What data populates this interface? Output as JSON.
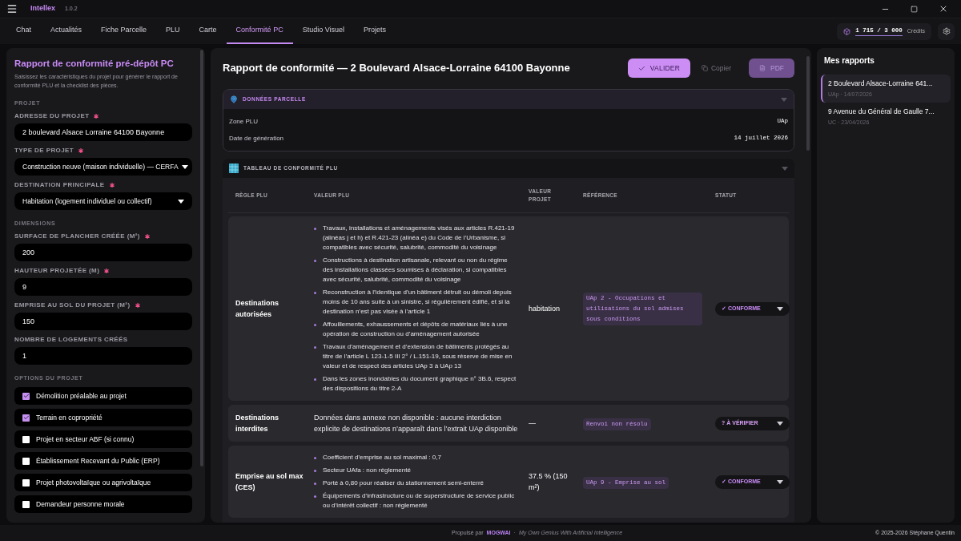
{
  "app": {
    "name": "Intellex",
    "version": "1.0.2"
  },
  "tabs": [
    {
      "label": "Chat",
      "selected": false
    },
    {
      "label": "Actualités",
      "selected": false
    },
    {
      "label": "Fiche Parcelle",
      "selected": false
    },
    {
      "label": "PLU",
      "selected": false
    },
    {
      "label": "Carte",
      "selected": false
    },
    {
      "label": "Conformité PC",
      "selected": true
    },
    {
      "label": "Studio Visuel",
      "selected": false
    },
    {
      "label": "Projets",
      "selected": false
    }
  ],
  "credits": {
    "value": "1 715 / 3 000",
    "label": "Crédits"
  },
  "form": {
    "title": "Rapport de conformité pré-dépôt PC",
    "subtitle": "Saisissez les caractéristiques du projet pour générer le rapport de conformité PLU et la checklist des pièces.",
    "sections": [
      {
        "heading": "PROJET",
        "fields": [
          {
            "label": "ADRESSE DU PROJET",
            "required": true,
            "kind": "input",
            "value": "2 boulevard Alsace Lorraine 64100 Bayonne"
          },
          {
            "label": "TYPE DE PROJET",
            "required": true,
            "kind": "select",
            "value": "Construction neuve (maison individuelle) — CERFA"
          },
          {
            "label": "DESTINATION PRINCIPALE",
            "required": true,
            "kind": "select",
            "value": "Habitation (logement individuel ou collectif)"
          }
        ]
      },
      {
        "heading": "DIMENSIONS",
        "fields": [
          {
            "label": "SURFACE DE PLANCHER CRÉÉE (M²)",
            "required": true,
            "kind": "input",
            "value": "200"
          },
          {
            "label": "HAUTEUR PROJETÉE (M)",
            "required": true,
            "kind": "input",
            "value": "9"
          },
          {
            "label": "EMPRISE AU SOL DU PROJET (M²)",
            "required": true,
            "kind": "input",
            "value": "150"
          },
          {
            "label": "NOMBRE DE LOGEMENTS CRÉÉS",
            "required": false,
            "kind": "input",
            "value": "1"
          }
        ]
      }
    ],
    "options_heading": "OPTIONS DU PROJET",
    "options": [
      {
        "label": "Démolition préalable au projet",
        "checked": true
      },
      {
        "label": "Terrain en copropriété",
        "checked": true
      },
      {
        "label": "Projet en secteur ABF (si connu)",
        "checked": false
      },
      {
        "label": "Établissement Recevant du Public (ERP)",
        "checked": false
      },
      {
        "label": "Projet photovoltaïque ou agrivoltaïque",
        "checked": false
      },
      {
        "label": "Demandeur personne morale",
        "checked": false
      }
    ]
  },
  "report": {
    "title": "Rapport de conformité — 2 Boulevard Alsace-Lorraine 64100 Bayonne",
    "buttons": {
      "validate": "VALIDER",
      "copy": "Copier",
      "pdf": "PDF"
    },
    "parcel": {
      "title": "DONNÉES PARCELLE",
      "expanded": true,
      "rows": [
        {
          "label": "Zone PLU",
          "value": "UAp"
        },
        {
          "label": "Date de génération",
          "value": "14 juillet 2026"
        }
      ]
    },
    "table": {
      "title": "TABLEAU DE CONFORMITÉ PLU",
      "expanded": true,
      "columns": [
        "RÈGLE PLU",
        "VALEUR PLU",
        "VALEUR PROJET",
        "RÉFÉRENCE",
        "STATUT"
      ],
      "rows": [
        {
          "rule": "Destinations autorisées",
          "plu_value": {
            "kind": "list",
            "items": [
              "Travaux, installations et aménagements visés aux articles R.421-19 (alinéas j et h) et R.421-23 (alinéa e) du Code de l’Urbanisme, si compatibles avec sécurité, salubrité, commodité du voisinage",
              "Constructions à destination artisanale, relevant ou non du régime des installations classées soumises à déclaration, si compatibles avec sécurité, salubrité, commodité du voisinage",
              "Reconstruction à l’identique d’un bâtiment détruit ou démoli depuis moins de 10 ans suite à un sinistre, si régulièrement édifié, et si la destination n’est pas visée à l’article 1",
              "Affouillements, exhaussements et dépôts de matériaux liés à une opération de construction ou d’aménagement autorisée",
              "Travaux d’aménagement et d’extension de bâtiments protégés au titre de l’article L 123-1-5 III 2° / L.151-19, sous réserve de mise en valeur et de respect des articles UAp 3 à UAp 13",
              "Dans les zones inondables du document graphique n° 3B.6, respect des dispositions du titre 2-A"
            ]
          },
          "project_value": "habitation",
          "reference": "UAp 2 - Occupations et utilisations du sol admises sous conditions",
          "status": {
            "kind": "conforme",
            "label": "✓ CONFORME"
          }
        },
        {
          "rule": "Destinations interdites",
          "plu_value": {
            "kind": "text",
            "text": "Données dans annexe non disponible : aucune interdiction explicite de destinations n’apparaît dans l’extrait UAp disponible"
          },
          "project_value": "—",
          "reference": "Renvoi non résolu",
          "status": {
            "kind": "verifier",
            "label": "? À VÉRIFIER"
          }
        },
        {
          "rule": "Emprise au sol max (CES)",
          "plu_value": {
            "kind": "list",
            "items": [
              "Coefficient d’emprise au sol maximal : 0,7",
              "Secteur UAfa : non réglementé",
              "Porté à 0,80 pour réaliser du stationnement semi-enterré",
              "Équipements d’infrastructure ou de superstructure de service public ou d’intérêt collectif : non réglementé"
            ]
          },
          "project_value": "37.5 % (150 m²)",
          "reference": "UAp 9 - Emprise au sol",
          "status": {
            "kind": "conforme",
            "label": "✓ CONFORME"
          }
        }
      ]
    }
  },
  "reports": {
    "title": "Mes rapports",
    "items": [
      {
        "title": "2 Boulevard Alsace-Lorraine 641...",
        "meta": "UAp · 14/07/2026",
        "selected": true
      },
      {
        "title": "9 Avenue du Général de Gaulle 7...",
        "meta": "UC · 23/04/2026",
        "selected": false
      }
    ]
  },
  "footer": {
    "prefix": "Propulsé par",
    "brand": "MOGWAI",
    "separator": "·",
    "tagline": "My Own Genius With Artificial Intelligence",
    "copyright": "© 2025-2026 Stéphane Quentin"
  }
}
